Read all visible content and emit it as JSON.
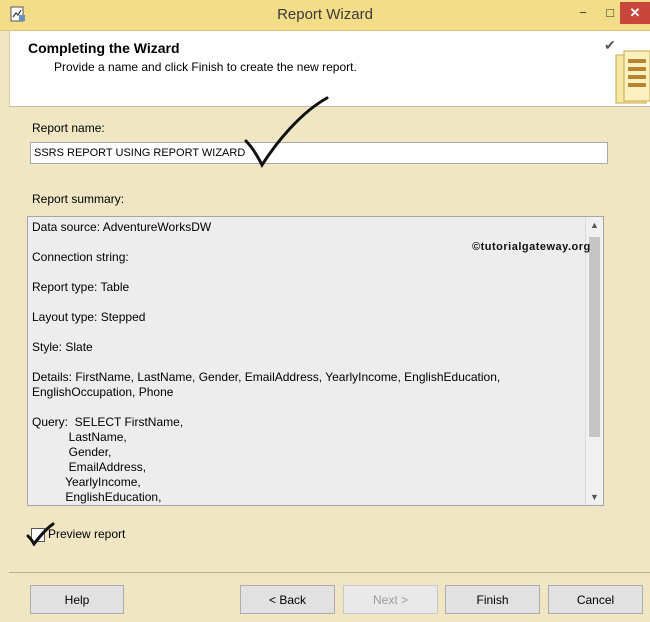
{
  "window": {
    "title": "Report Wizard",
    "minimize": "−",
    "maximize": "□",
    "close": "✕"
  },
  "header": {
    "title": "Completing the Wizard",
    "subtitle": "Provide a name and click Finish to create the new report."
  },
  "report_name": {
    "label": "Report name:",
    "value": "SSRS REPORT USING REPORT WIZARD"
  },
  "summary": {
    "label": "Report summary:",
    "lines": [
      "Data source: AdventureWorksDW",
      "",
      "Connection string:",
      "",
      "Report type: Table",
      "",
      "Layout type: Stepped",
      "",
      "Style: Slate",
      "",
      "Details: FirstName, LastName, Gender, EmailAddress, YearlyIncome, EnglishEducation,",
      "EnglishOccupation, Phone",
      "",
      "Query:  SELECT FirstName,",
      "           LastName,",
      "           Gender,",
      "           EmailAddress,",
      "          YearlyIncome,",
      "          EnglishEducation,"
    ]
  },
  "watermark": "©tutorialgateway.org",
  "preview": {
    "label": "Preview report",
    "checked": true
  },
  "buttons": {
    "help": "Help",
    "back": "< Back",
    "next": "Next >",
    "finish": "Finish",
    "cancel": "Cancel"
  },
  "icons": {
    "app": "report-wizard-app-icon",
    "header_check": "checkmark-icon",
    "header_graphic": "wizard-banner-graphic",
    "scroll_up": "scroll-up-arrow-icon",
    "scroll_down": "scroll-down-arrow-icon"
  },
  "colors": {
    "window_background": "#f0e6c4",
    "titlebar": "#f3dd88",
    "close_button": "#c7483b",
    "summary_background": "#ededed"
  }
}
